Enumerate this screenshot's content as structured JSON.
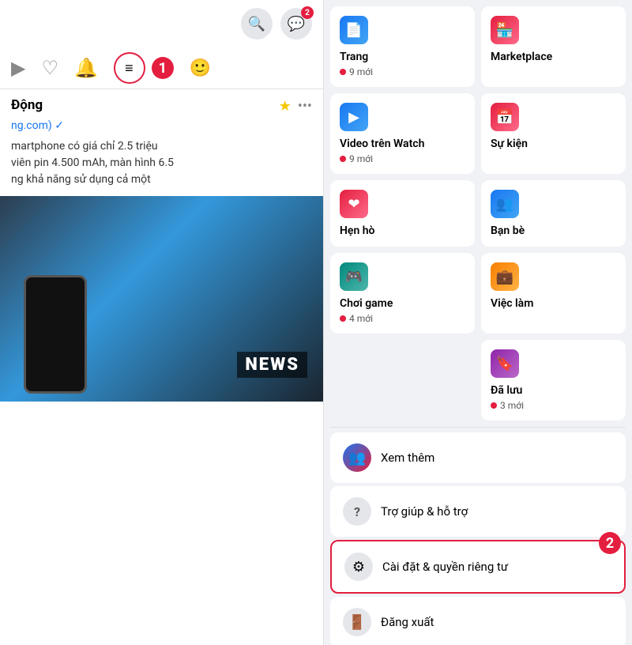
{
  "left": {
    "search_icon": "🔍",
    "messenger_icon": "💬",
    "messenger_badge": "2",
    "nav_icons": [
      "▶",
      "♡",
      "🔔"
    ],
    "menu_icon": "≡",
    "step1_label": "1",
    "post": {
      "title": "Động",
      "subtitle": "ng.com) ✓",
      "text_lines": [
        "martphone có giá chỉ 2.5 triệu",
        "viên pin 4.500 mAh, màn hình 6.5",
        "ng khả năng sử dụng cả một"
      ],
      "image_label": "NEWS"
    }
  },
  "right": {
    "items_row1": [
      {
        "label": "Trang",
        "sublabel": "9 mới",
        "icon": "📄",
        "icon_color": "icon-blue"
      },
      {
        "label": "Marketplace",
        "sublabel": "",
        "icon": "🏪",
        "icon_color": "icon-red"
      }
    ],
    "items_row2": [
      {
        "label": "Video trên Watch",
        "sublabel": "9 mới",
        "icon": "▶",
        "icon_color": "icon-blue"
      },
      {
        "label": "Sự kiện",
        "sublabel": "",
        "icon": "📅",
        "icon_color": "icon-red"
      }
    ],
    "items_row3": [
      {
        "label": "Hẹn hò",
        "sublabel": "",
        "icon": "❤",
        "icon_color": "icon-red"
      },
      {
        "label": "Bạn bè",
        "sublabel": "",
        "icon": "👥",
        "icon_color": "icon-blue"
      }
    ],
    "items_row4": [
      {
        "label": "Chơi game",
        "sublabel": "4 mới",
        "icon": "🎮",
        "icon_color": "icon-teal"
      },
      {
        "label": "Việc làm",
        "sublabel": "",
        "icon": "💼",
        "icon_color": "icon-orange"
      }
    ],
    "items_row5_right": {
      "label": "Đã lưu",
      "sublabel": "3 mới",
      "icon": "🔖",
      "icon_color": "icon-purple"
    },
    "list_items": [
      {
        "label": "Xem thêm",
        "icon": "👥",
        "icon_color": "icon-blue"
      },
      {
        "label": "Trợ giúp & hỗ trợ",
        "icon": "?",
        "icon_color": "icon-grey"
      }
    ],
    "settings_item": {
      "label": "Cài đặt & quyền riêng tư",
      "icon": "⚙",
      "icon_color": "icon-grey"
    },
    "logout_item": {
      "label": "Đăng xuất",
      "icon": "🚪",
      "icon_color": "icon-grey"
    },
    "step2_label": "2"
  }
}
